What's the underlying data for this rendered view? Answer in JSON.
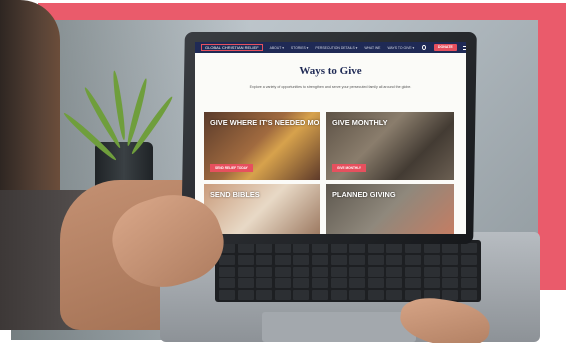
{
  "scene": {
    "description_colors": {
      "frame_accent": "#ea5b6b",
      "site_nav": "#1f2a55",
      "site_accent": "#e6505e"
    }
  },
  "website": {
    "logo": "GLOBAL CHRISTIAN RELIEF",
    "nav_items": [
      "ABOUT ▾",
      "STORIES ▾",
      "PERSECUTION DETAILS ▾",
      "WHAT WE",
      "WAYS TO GIVE ▾"
    ],
    "search_icon": "search-icon",
    "donate_label": "DONATE ▸",
    "menu_icon": "hamburger-icon",
    "page_title": "Ways to Give",
    "page_subtitle": "Explore a variety of opportunities to strengthen and serve your persecuted family all around the globe.",
    "cards": [
      {
        "title": "GIVE WHERE IT'S NEEDED MOST",
        "button": "SEND RELIEF TODAY"
      },
      {
        "title": "GIVE MONTHLY",
        "button": "GIVE MONTHLY"
      },
      {
        "title": "SEND BIBLES",
        "button": ""
      },
      {
        "title": "PLANNED GIVING",
        "button": ""
      }
    ]
  }
}
